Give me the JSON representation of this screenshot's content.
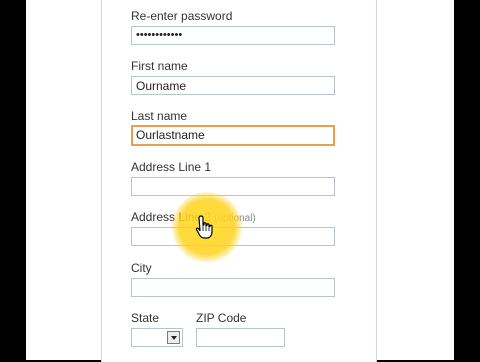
{
  "form": {
    "reenter_password": {
      "label": "Re-enter password",
      "value": "••••••••••••"
    },
    "first_name": {
      "label": "First name",
      "value": "Ourname"
    },
    "last_name": {
      "label": "Last name",
      "value": "Ourlastname"
    },
    "address1": {
      "label": "Address Line 1",
      "value": ""
    },
    "address2": {
      "label": "Address Line 2",
      "optional": "(optional)",
      "value": ""
    },
    "city": {
      "label": "City",
      "value": ""
    },
    "state": {
      "label": "State",
      "selected": ""
    },
    "zip": {
      "label": "ZIP Code",
      "value": ""
    }
  },
  "colors": {
    "focus_border": "#e8a14a",
    "input_border": "#b9c3cd",
    "cursor_highlight": "#ffd21e"
  },
  "icons": {
    "cursor": "hand-pointer-icon",
    "dropdown": "chevron-down-icon"
  }
}
